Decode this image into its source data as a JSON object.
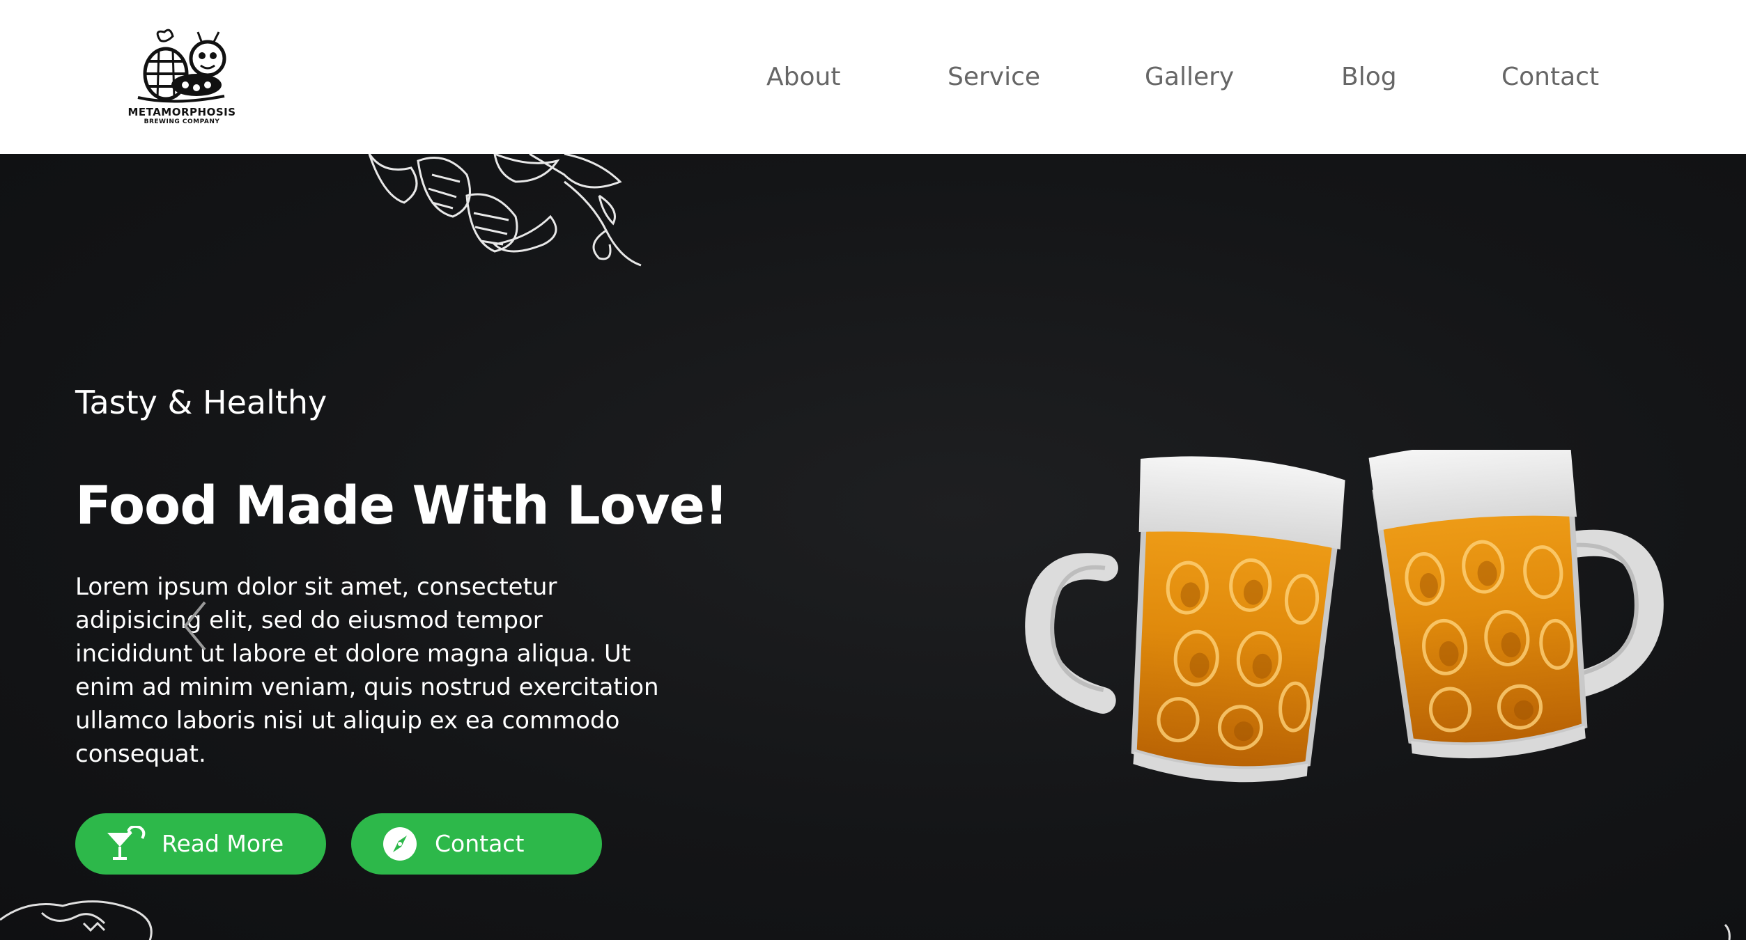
{
  "brand": {
    "name": "METAMORPHOSIS",
    "subtitle": "BREWING COMPANY"
  },
  "nav": {
    "items": [
      {
        "label": "About"
      },
      {
        "label": "Service"
      },
      {
        "label": "Gallery"
      },
      {
        "label": "Blog"
      },
      {
        "label": "Contact"
      }
    ]
  },
  "hero": {
    "subtitle": "Tasty & Healthy",
    "title": "Food Made With Love!",
    "text": "Lorem ipsum dolor sit amet, consectetur adipisicing elit, sed do eiusmod tempor incididunt ut labore et dolore magna aliqua. Ut enim ad minim veniam, quis nostrud exercitation ullamco laboris nisi ut aliquip ex ea commodo consequat.",
    "buttons": {
      "read_more": "Read More",
      "contact": "Contact"
    }
  },
  "colors": {
    "accent": "#2db84a",
    "nav_text": "#666666",
    "hero_bg": "#141517"
  },
  "icons": {
    "read_more": "cocktail-icon",
    "contact": "compass-icon",
    "prev": "chevron-left-icon",
    "next": "chevron-right-icon"
  }
}
